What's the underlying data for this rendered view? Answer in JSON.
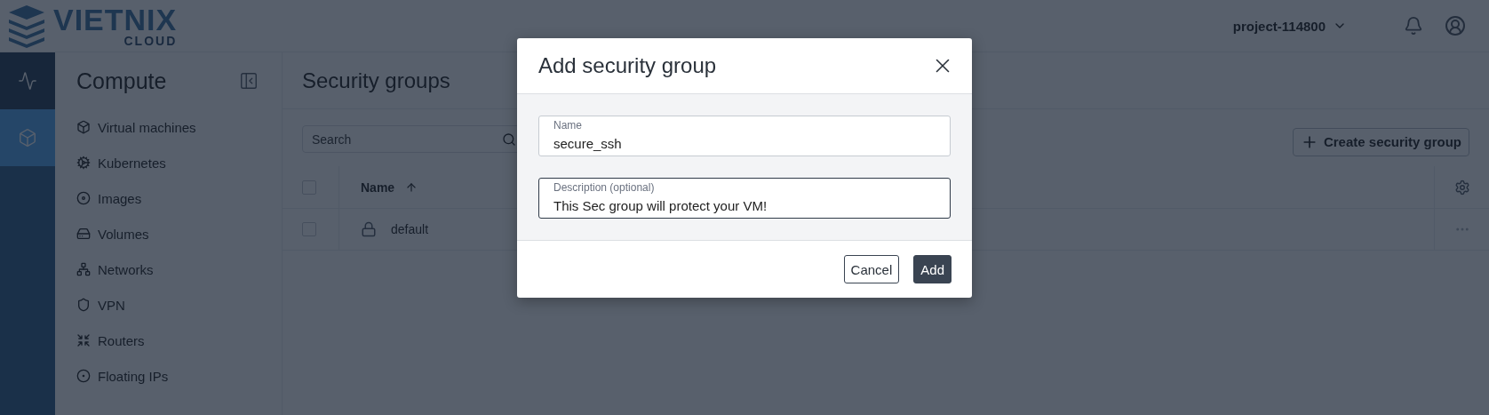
{
  "header": {
    "logo": {
      "name": "VIETNIX",
      "tagline": "CLOUD"
    },
    "project": "project-114800"
  },
  "rail": [
    {
      "selected": false
    },
    {
      "selected": true
    }
  ],
  "sidebar": {
    "title": "Compute",
    "items": [
      {
        "label": "Virtual machines"
      },
      {
        "label": "Kubernetes"
      },
      {
        "label": "Images"
      },
      {
        "label": "Volumes"
      },
      {
        "label": "Networks"
      },
      {
        "label": "VPN"
      },
      {
        "label": "Routers"
      },
      {
        "label": "Floating IPs"
      }
    ]
  },
  "page": {
    "title": "Security groups",
    "search": {
      "placeholder": "Search"
    },
    "create_button": "Create security group",
    "table": {
      "select_all": {
        "checked": false
      },
      "columns": [
        {
          "label": "Name"
        }
      ],
      "rows": [
        {
          "name": "default",
          "checked": false
        }
      ]
    }
  },
  "dialog": {
    "title": "Add security group",
    "fields": [
      {
        "label": "Name",
        "value": "secure_ssh",
        "focused": false
      },
      {
        "label": "Description (optional)",
        "value": "This Sec group will protect your VM!",
        "focused": true
      }
    ],
    "buttons": [
      {
        "label": "Cancel",
        "kind": "secondary"
      },
      {
        "label": "Add",
        "kind": "primary"
      }
    ]
  }
}
